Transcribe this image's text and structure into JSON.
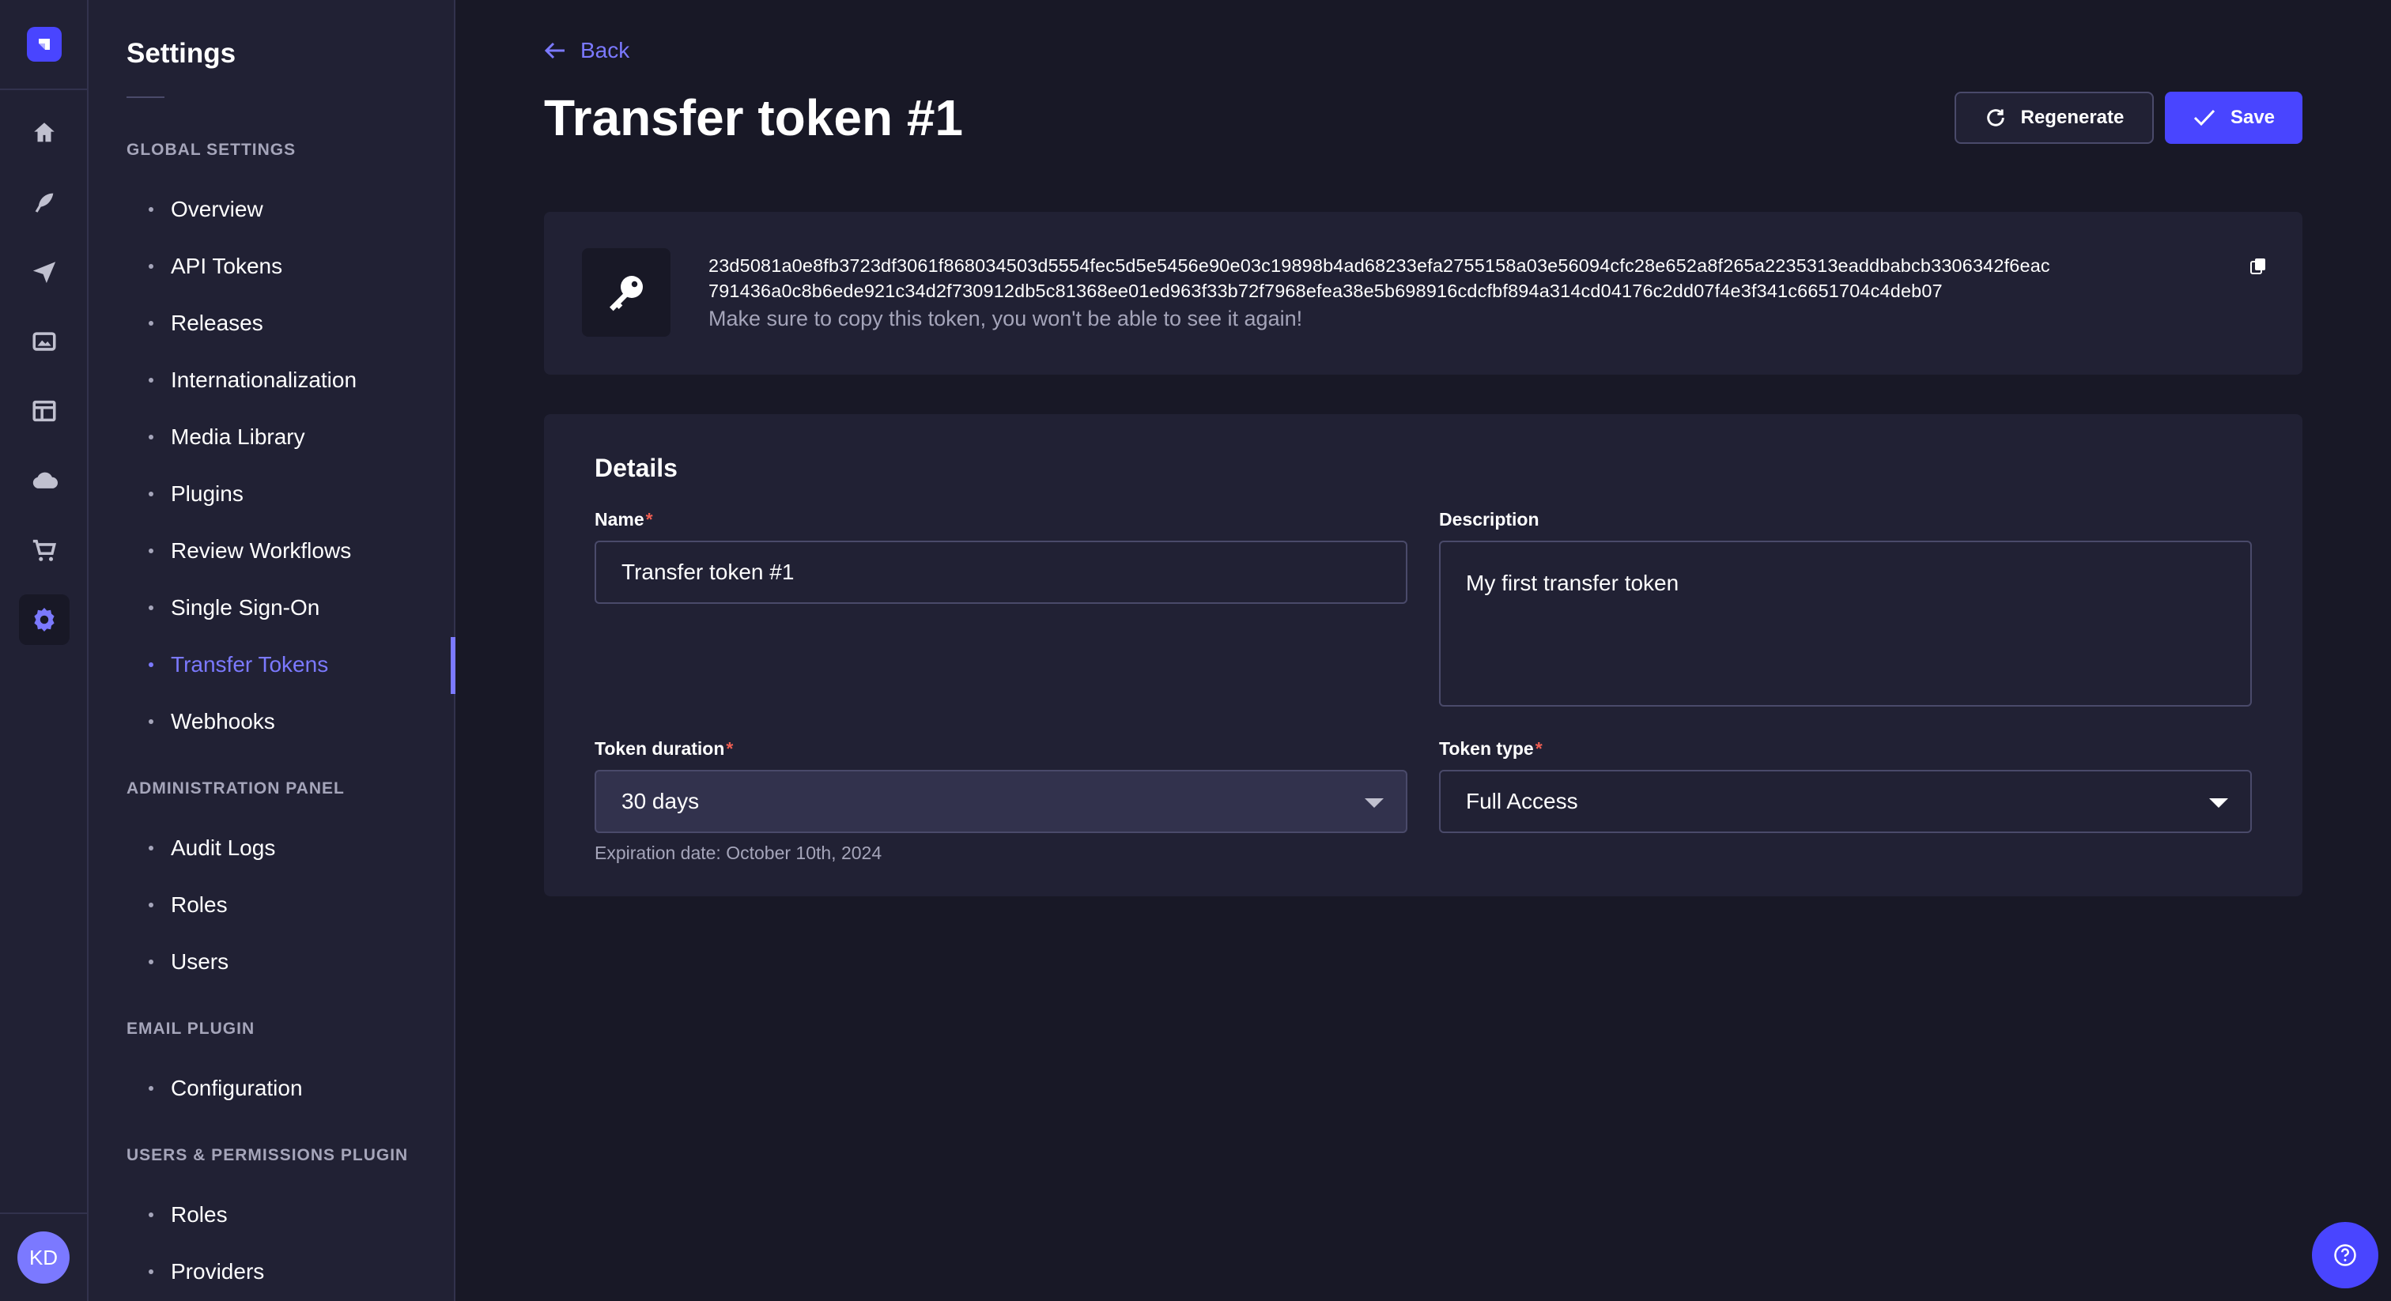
{
  "sidebar": {
    "title": "Settings",
    "sections": [
      {
        "label": "GLOBAL SETTINGS",
        "items": [
          "Overview",
          "API Tokens",
          "Releases",
          "Internationalization",
          "Media Library",
          "Plugins",
          "Review Workflows",
          "Single Sign-On",
          "Transfer Tokens",
          "Webhooks"
        ]
      },
      {
        "label": "ADMINISTRATION PANEL",
        "items": [
          "Audit Logs",
          "Roles",
          "Users"
        ]
      },
      {
        "label": "EMAIL PLUGIN",
        "items": [
          "Configuration"
        ]
      },
      {
        "label": "USERS & PERMISSIONS PLUGIN",
        "items": [
          "Roles",
          "Providers"
        ]
      }
    ],
    "active_item": "Transfer Tokens"
  },
  "rail": {
    "icons": [
      "home-icon",
      "feather-icon",
      "paper-plane-icon",
      "images-icon",
      "layout-icon",
      "cloud-icon",
      "cart-icon",
      "gear-icon"
    ],
    "active_icon": "gear-icon",
    "avatar_initials": "KD"
  },
  "header": {
    "back_label": "Back",
    "title": "Transfer token #1",
    "regenerate_label": "Regenerate",
    "save_label": "Save"
  },
  "token": {
    "value": "23d5081a0e8fb3723df3061f868034503d5554fec5d5e5456e90e03c19898b4ad68233efa2755158a03e56094cfc28e652a8f265a2235313eaddbabcb3306342f6eac791436a0c8b6ede921c34d2f730912db5c81368ee01ed963f33b72f7968efea38e5b698916cdcfbf894a314cd04176c2dd07f4e3f341c6651704c4deb07",
    "line1": "23d5081a0e8fb3723df3061f868034503d5554fec5d5e5456e90e03c19898b4ad68233efa2755158a03e56094cfc28e652a8f265a2235313eaddbabcb3306342f6eac",
    "line2": "791436a0c8b6ede921c34d2f730912db5c81368ee01ed963f33b72f7968efea38e5b698916cdcfbf894a314cd04176c2dd07f4e3f341c6651704c4deb07",
    "note": "Make sure to copy this token, you won't be able to see it again!"
  },
  "details": {
    "title": "Details",
    "name_label": "Name",
    "name_value": "Transfer token #1",
    "description_label": "Description",
    "description_value": "My first transfer token",
    "duration_label": "Token duration",
    "duration_value": "30 days",
    "expiration_hint": "Expiration date: October 10th, 2024",
    "type_label": "Token type",
    "type_value": "Full Access"
  },
  "colors": {
    "accent": "#4945ff",
    "accent_light": "#7b79ff",
    "background": "#181826",
    "surface": "#212134",
    "required": "#ee5e52"
  }
}
